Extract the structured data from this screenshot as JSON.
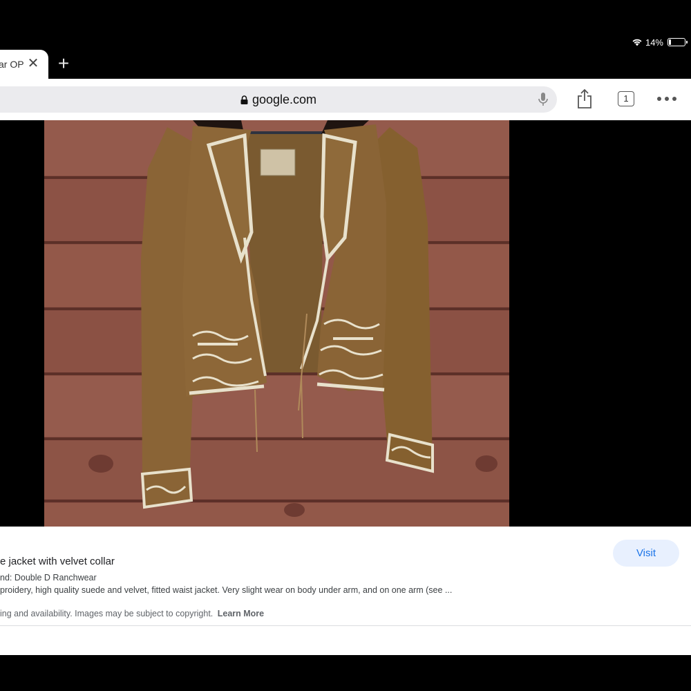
{
  "status": {
    "battery_text": "14%",
    "battery_level": 0.14
  },
  "tab": {
    "title": "ar OP",
    "close_glyph": "✕",
    "new_tab_glyph": "+"
  },
  "toolbar": {
    "address": "google.com",
    "tab_count": "1"
  },
  "result": {
    "title": "e jacket with velvet collar",
    "brand": "nd: Double D Ranchwear",
    "description": "proidery, high quality suede and velvet, fitted waist jacket. Very slight wear on body under arm, and on one arm (see ...",
    "note": "ing and availability. Images may be subject to copyright.",
    "learn_more": "Learn More",
    "visit_label": "Visit"
  },
  "colors": {
    "wood": "#8a4f43",
    "suede": "#8a6436",
    "embroidery": "#e8e1cc",
    "accent": "#1a73e8"
  }
}
